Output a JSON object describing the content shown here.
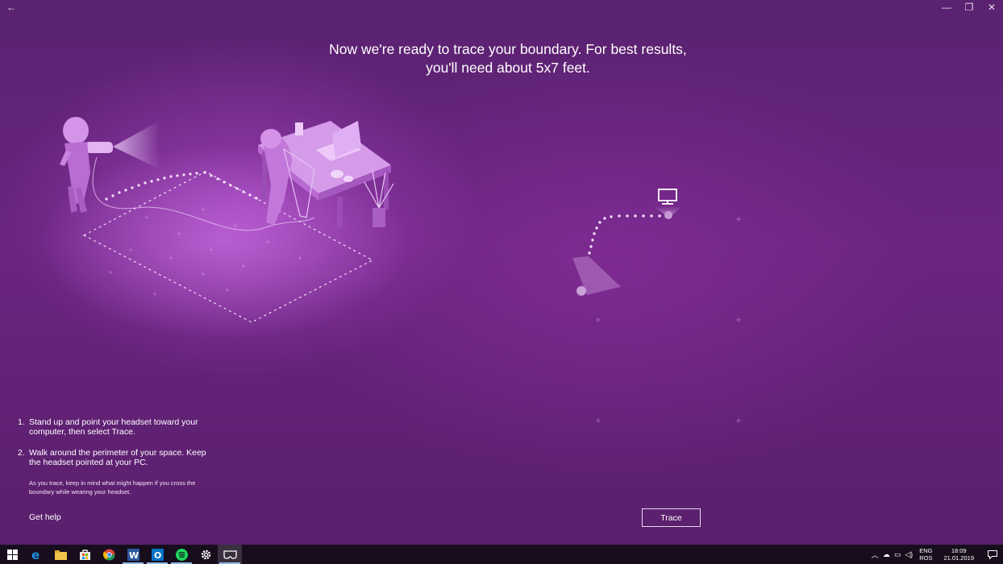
{
  "window": {
    "back_icon": "back-arrow-icon",
    "minimize_glyph": "—",
    "maximize_glyph": "❐",
    "close_glyph": "✕",
    "back_glyph": "←"
  },
  "main": {
    "title_line1": "Now we're ready to trace your boundary. For best results,",
    "title_line2": "you'll need about 5x7 feet.",
    "steps": [
      {
        "num": "1.",
        "text": "Stand up and point your headset toward your computer, then select Trace."
      },
      {
        "num": "2.",
        "text": "Walk around the perimeter of your space. Keep the headset pointed at your PC."
      }
    ],
    "note": "As you trace, keep in mind what might happen if you cross the boundary while wearing your headset.",
    "get_help_label": "Get help",
    "trace_label": "Trace"
  },
  "taskbar": {
    "icons": [
      "windows-start-icon",
      "edge-icon",
      "file-explorer-icon",
      "store-icon",
      "chrome-icon",
      "word-icon",
      "outlook-icon",
      "spotify-icon",
      "settings-icon",
      "mixed-reality-portal-icon"
    ],
    "lang_top": "ENG",
    "lang_bottom": "ROS",
    "time": "18:09",
    "date": "21.01.2019"
  },
  "colors": {
    "background": "#6a2580",
    "taskbar": "#170d1d",
    "accent": "#8fb8e0"
  }
}
